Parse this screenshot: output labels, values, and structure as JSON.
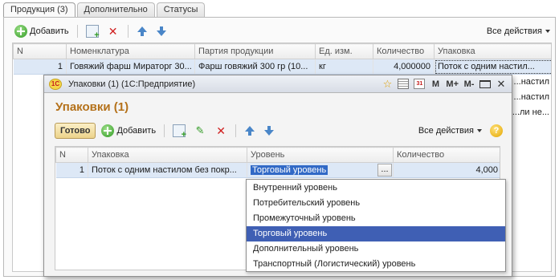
{
  "main": {
    "tabs": [
      {
        "label": "Продукция (3)",
        "active": true
      },
      {
        "label": "Дополнительно",
        "active": false
      },
      {
        "label": "Статусы",
        "active": false
      }
    ],
    "toolbar": {
      "add_label": "Добавить",
      "all_actions_label": "Все действия"
    },
    "columns": [
      "N",
      "Номенклатура",
      "Партия продукции",
      "Ед. изм.",
      "Количество",
      "Упаковка"
    ],
    "rows": [
      {
        "n": "1",
        "nomenclature": "Говяжий фарш Мираторг 30...",
        "batch": "Фарш говяжий 300 гр (10...",
        "unit": "кг",
        "qty": "4,000000",
        "pack": "Поток с одним настил..."
      },
      {
        "n": "",
        "nomenclature": "",
        "batch": "",
        "unit": "",
        "qty": "",
        "pack": "...настил"
      },
      {
        "n": "",
        "nomenclature": "",
        "batch": "",
        "unit": "",
        "qty": "",
        "pack": "...настил"
      },
      {
        "n": "",
        "nomenclature": "",
        "batch": "",
        "unit": "",
        "qty": "",
        "pack": "...ли не..."
      }
    ]
  },
  "modal": {
    "window_title": "Упаковки (1) (1С:Предприятие)",
    "heading": "Упаковки (1)",
    "logo_text": "1С",
    "titlebar_buttons": {
      "m": "M",
      "m_plus": "M+",
      "m_minus": "M-",
      "calendar_text": "31"
    },
    "toolbar": {
      "done_label": "Готово",
      "add_label": "Добавить",
      "all_actions_label": "Все действия",
      "help_text": "?"
    },
    "columns": [
      "N",
      "Упаковка",
      "Уровень",
      "Количество"
    ],
    "rows": [
      {
        "n": "1",
        "pack": "Поток с одним настилом без покр...",
        "level": "Торговый уровень",
        "qty": "4,000"
      }
    ],
    "ellipsis": "..."
  },
  "level_dropdown": {
    "options": [
      "Внутренний уровень",
      "Потребительский уровень",
      "Промежуточный уровень",
      "Торговый уровень",
      "Дополнительный уровень",
      "Транспортный (Логистический) уровень"
    ],
    "selected_index": 3
  }
}
